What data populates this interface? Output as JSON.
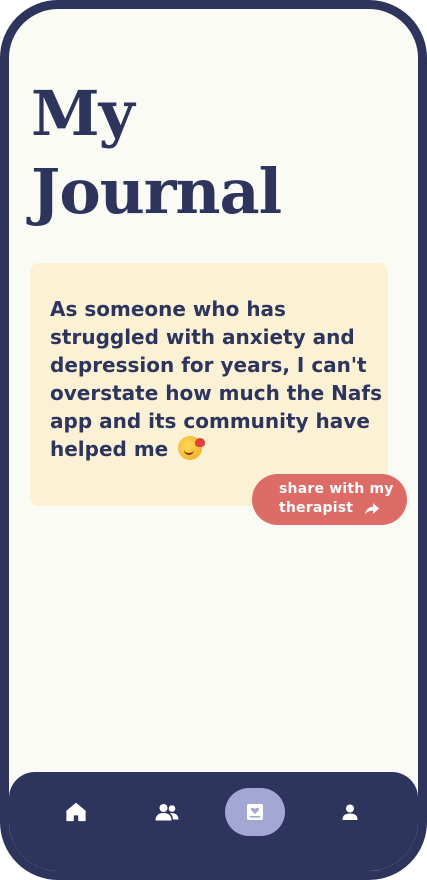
{
  "page": {
    "title_line1": "My",
    "title_line2": "Journal"
  },
  "journal_entry": {
    "text": "As someone who has struggled with anxiety and depression for years, I can't overstate how much the Nafs app and its community have helped me",
    "emoji": "smiling-face-with-hearts"
  },
  "share_button": {
    "line1": "share with my",
    "line2": "therapist",
    "icon": "share-arrow-icon"
  },
  "bottom_nav": {
    "items": [
      {
        "name": "home",
        "icon": "home-icon",
        "active": false
      },
      {
        "name": "community",
        "icon": "people-icon",
        "active": false
      },
      {
        "name": "journal",
        "icon": "journal-icon",
        "active": true
      },
      {
        "name": "profile",
        "icon": "person-icon",
        "active": false
      }
    ]
  },
  "colors": {
    "frame": "#2e355d",
    "background": "#fafbf5",
    "card": "#fbf2d6",
    "accent": "#dd6b66",
    "nav_active": "#a4a7d4"
  }
}
